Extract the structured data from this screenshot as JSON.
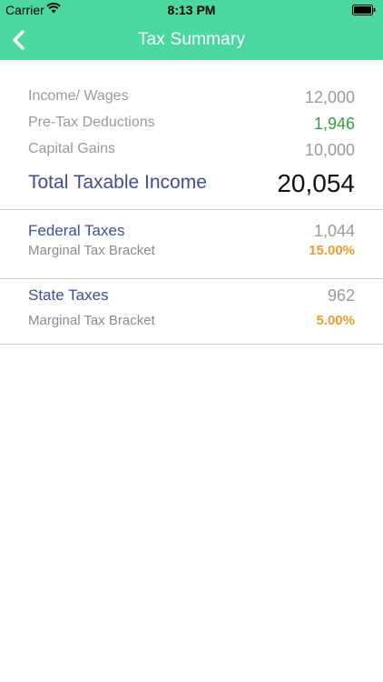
{
  "status_bar": {
    "carrier": "Carrier",
    "time": "8:13 PM"
  },
  "nav": {
    "title": "Tax Summary",
    "accent_color": "#4ad89f"
  },
  "income": {
    "rows": [
      {
        "label": "Income/ Wages",
        "value": "12,000"
      },
      {
        "label": "Pre-Tax Deductions",
        "value": "1,946"
      },
      {
        "label": "Capital Gains",
        "value": "10,000"
      }
    ],
    "total_label": "Total Taxable Income",
    "total_value": "20,054"
  },
  "federal": {
    "label": "Federal Taxes",
    "value": "1,044",
    "bracket_label": "Marginal Tax Bracket",
    "bracket_value": "15.00%"
  },
  "state": {
    "label": "State Taxes",
    "value": "962",
    "bracket_label": "Marginal Tax Bracket",
    "bracket_value": "5.00%"
  },
  "icons": {
    "back": "chevron-left-icon",
    "wifi": "wifi-icon",
    "battery": "battery-icon"
  }
}
